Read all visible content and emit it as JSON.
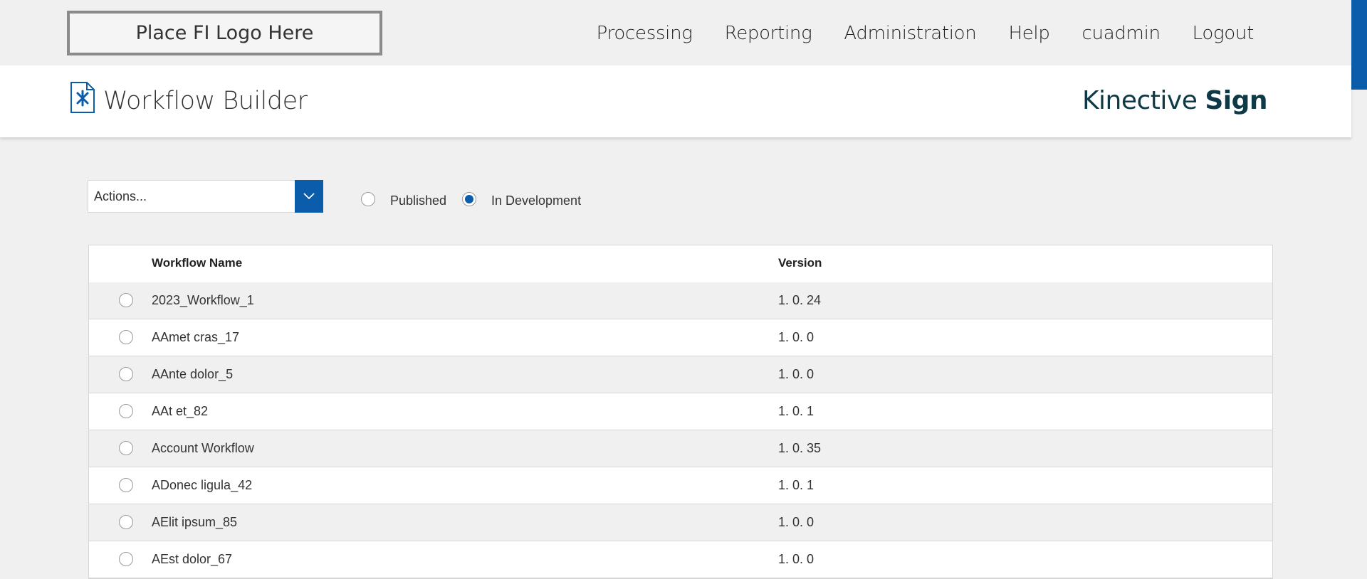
{
  "header": {
    "logo_text": "Place FI Logo Here",
    "nav": [
      "Processing",
      "Reporting",
      "Administration",
      "Help",
      "cuadmin",
      "Logout"
    ]
  },
  "titlebar": {
    "title": "Workflow Builder",
    "brand_light": "Kinective ",
    "brand_bold": "Sign"
  },
  "toolbar": {
    "actions_placeholder": "Actions...",
    "filter_options": [
      {
        "label": "Published",
        "checked": false
      },
      {
        "label": "In Development",
        "checked": true
      }
    ]
  },
  "table": {
    "columns": [
      "Workflow Name",
      "Version"
    ],
    "rows": [
      {
        "name": "2023_Workflow_1",
        "version": "1. 0. 24"
      },
      {
        "name": "AAmet cras_17",
        "version": "1. 0. 0"
      },
      {
        "name": "AAnte dolor_5",
        "version": "1. 0. 0"
      },
      {
        "name": "AAt et_82",
        "version": "1. 0. 1"
      },
      {
        "name": "Account Workflow",
        "version": "1. 0. 35"
      },
      {
        "name": "ADonec ligula_42",
        "version": "1. 0. 1"
      },
      {
        "name": "AElit ipsum_85",
        "version": "1. 0. 0"
      },
      {
        "name": "AEst dolor_67",
        "version": "1. 0. 0"
      }
    ]
  },
  "colors": {
    "accent": "#0b5cab",
    "brand_text": "#0e3a47",
    "background": "#f0f0f0"
  }
}
